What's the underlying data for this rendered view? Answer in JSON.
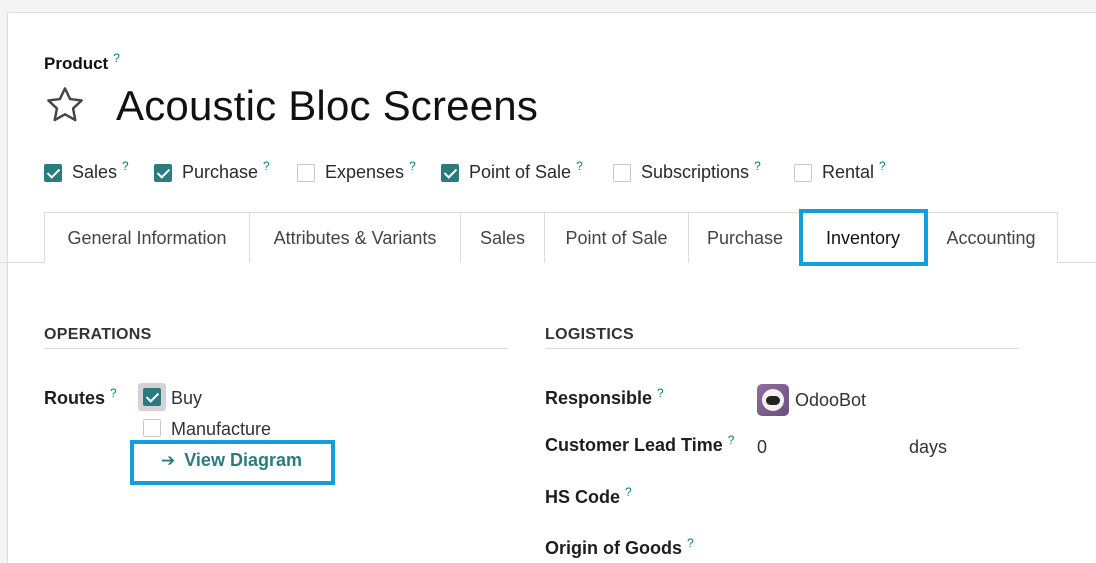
{
  "header": {
    "product_label": "Product",
    "help": "?",
    "title": "Acoustic Bloc Screens"
  },
  "options": [
    {
      "label": "Sales",
      "checked": true
    },
    {
      "label": "Purchase",
      "checked": true
    },
    {
      "label": "Expenses",
      "checked": false
    },
    {
      "label": "Point of Sale",
      "checked": true
    },
    {
      "label": "Subscriptions",
      "checked": false
    },
    {
      "label": "Rental",
      "checked": false
    }
  ],
  "tabs": [
    {
      "label": "General Information"
    },
    {
      "label": "Attributes & Variants"
    },
    {
      "label": "Sales"
    },
    {
      "label": "Point of Sale"
    },
    {
      "label": "Purchase"
    },
    {
      "label": "Inventory",
      "active": true
    },
    {
      "label": "Accounting"
    }
  ],
  "operations": {
    "heading": "OPERATIONS",
    "routes_label": "Routes",
    "routes": [
      {
        "label": "Buy",
        "checked": true
      },
      {
        "label": "Manufacture",
        "checked": false
      }
    ],
    "view_diagram": "View Diagram",
    "arrow": "➔"
  },
  "logistics": {
    "heading": "LOGISTICS",
    "responsible_label": "Responsible",
    "responsible_value": "OdooBot",
    "lead_time_label": "Customer Lead Time",
    "lead_time_value": "0",
    "lead_time_unit": "days",
    "hs_code_label": "HS Code",
    "origin_label": "Origin of Goods"
  },
  "colors": {
    "accent": "#2b7c7f",
    "highlight": "#12a0dc"
  }
}
